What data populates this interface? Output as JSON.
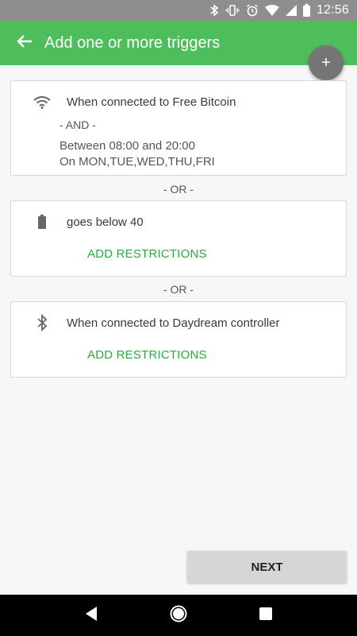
{
  "status_bar": {
    "time": "12:56"
  },
  "app_bar": {
    "title": "Add one or more triggers",
    "add_label": "+"
  },
  "triggers": [
    {
      "icon": "wifi-icon",
      "text": "When connected to Free Bitcoin",
      "and_label": "- AND -",
      "time_range": "Between 08:00 and 20:00",
      "days": "On MON,TUE,WED,THU,FRI"
    },
    {
      "icon": "battery-icon",
      "text": "goes below 40",
      "action": "ADD RESTRICTIONS"
    },
    {
      "icon": "bluetooth-icon",
      "text": "When connected to Daydream controller",
      "action": "ADD RESTRICTIONS"
    }
  ],
  "or_label": "- OR -",
  "next_button": "NEXT",
  "colors": {
    "primary": "#4ebe5c",
    "accent": "#27ad3b",
    "status_bar": "#8e8e8e",
    "fab": "#757575"
  }
}
